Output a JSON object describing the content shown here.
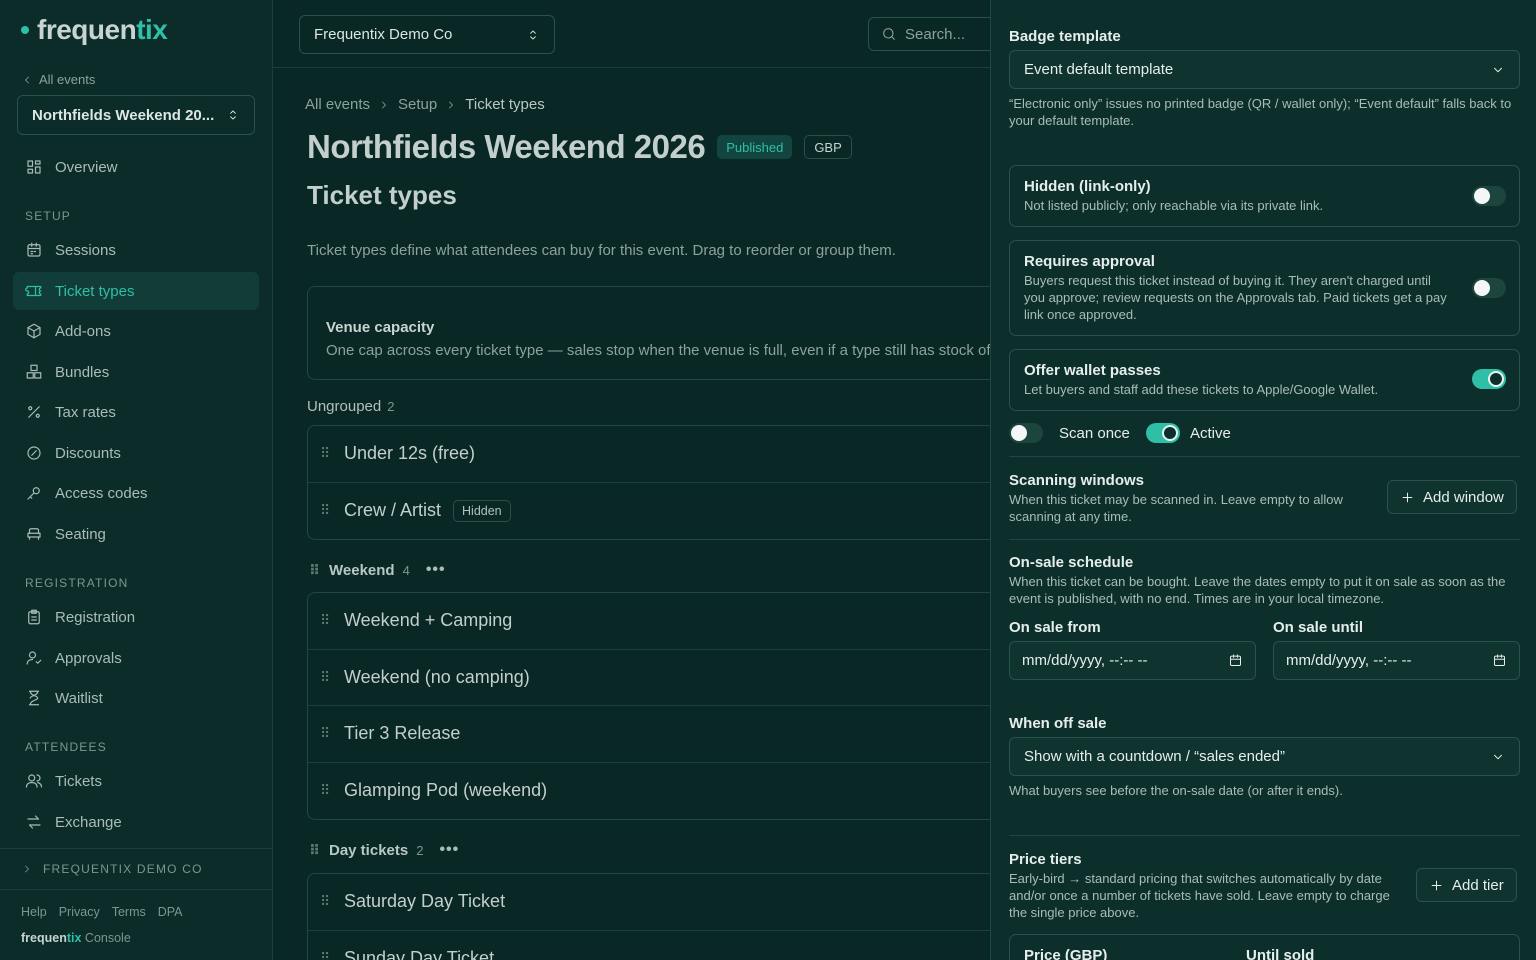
{
  "brand": {
    "name_a": "frequen",
    "name_b": "tix",
    "accent": "#2fbfa6"
  },
  "sidebar": {
    "back_label": "All events",
    "event_selector": "Northfields Weekend 20...",
    "overview": "Overview",
    "sections": [
      {
        "heading": "SETUP",
        "items": [
          "Sessions",
          "Ticket types",
          "Add-ons",
          "Bundles",
          "Tax rates",
          "Discounts",
          "Access codes",
          "Seating"
        ]
      },
      {
        "heading": "REGISTRATION",
        "items": [
          "Registration",
          "Approvals",
          "Waitlist"
        ]
      },
      {
        "heading": "ATTENDEES",
        "items": [
          "Tickets",
          "Exchange"
        ]
      }
    ],
    "active_item": "Ticket types",
    "org_link": "FREQUENTIX DEMO CO",
    "footer_links": [
      "Help",
      "Privacy",
      "Terms",
      "DPA"
    ],
    "console_suffix": "Console"
  },
  "topbar": {
    "org_selector": "Frequentix Demo Co",
    "search_placeholder": "Search..."
  },
  "main": {
    "breadcrumb": [
      "All events",
      "Setup",
      "Ticket types"
    ],
    "event_title": "Northfields Weekend 2026",
    "status_badge": "Published",
    "currency_badge": "GBP",
    "page_title": "Ticket types",
    "description": "Ticket types define what attendees can buy for this event. Drag to reorder or group them.",
    "venue_capacity": {
      "title": "Venue capacity",
      "text": "One cap across every ticket type — sales stop when the venue is full, even if a type still has stock of"
    },
    "ungrouped": {
      "label": "Ungrouped",
      "count": "2",
      "items": [
        {
          "name": "Under 12s (free)"
        },
        {
          "name": "Crew / Artist",
          "badge": "Hidden"
        }
      ]
    },
    "groups": [
      {
        "name": "Weekend",
        "count": "4",
        "items": [
          "Weekend + Camping",
          "Weekend (no camping)",
          "Tier 3 Release",
          "Glamping Pod (weekend)"
        ]
      },
      {
        "name": "Day tickets",
        "count": "2",
        "items": [
          "Saturday Day Ticket",
          "Sunday Day Ticket"
        ]
      }
    ]
  },
  "panel": {
    "badge_template": {
      "label": "Badge template",
      "value": "Event default template",
      "help": "“Electronic only” issues no printed badge (QR / wallet only); “Event default” falls back to your default template."
    },
    "hidden": {
      "title": "Hidden (link-only)",
      "desc": "Not listed publicly; only reachable via its private link.",
      "on": false
    },
    "requires_approval": {
      "title": "Requires approval",
      "desc": "Buyers request this ticket instead of buying it. They aren't charged until you approve; review requests on the Approvals tab. Paid tickets get a pay link once approved.",
      "on": false
    },
    "wallet": {
      "title": "Offer wallet passes",
      "desc": "Let buyers and staff add these tickets to Apple/Google Wallet.",
      "on": true
    },
    "scan_once": {
      "label": "Scan once",
      "on": false
    },
    "active": {
      "label": "Active",
      "on": true
    },
    "scanning_windows": {
      "title": "Scanning windows",
      "desc": "When this ticket may be scanned in. Leave empty to allow scanning at any time.",
      "button": "Add window"
    },
    "on_sale": {
      "title": "On-sale schedule",
      "desc": "When this ticket can be bought. Leave the dates empty to put it on sale as soon as the event is published, with no end. Times are in your local timezone.",
      "from_label": "On sale from",
      "until_label": "On sale until",
      "from_placeholder": "mm/dd/yyyy, --:-- --",
      "until_placeholder": "mm/dd/yyyy, --:-- --"
    },
    "off_sale": {
      "label": "When off sale",
      "value": "Show with a countdown / “sales ended”",
      "help": "What buyers see before the on-sale date (or after it ends)."
    },
    "price_tiers": {
      "title": "Price tiers",
      "desc": "Early-bird → standard pricing that switches automatically by date and/or once a number of tickets have sold. Leave empty to charge the single price above.",
      "button": "Add tier",
      "col_price": "Price (GBP)",
      "col_until": "Until sold"
    }
  }
}
